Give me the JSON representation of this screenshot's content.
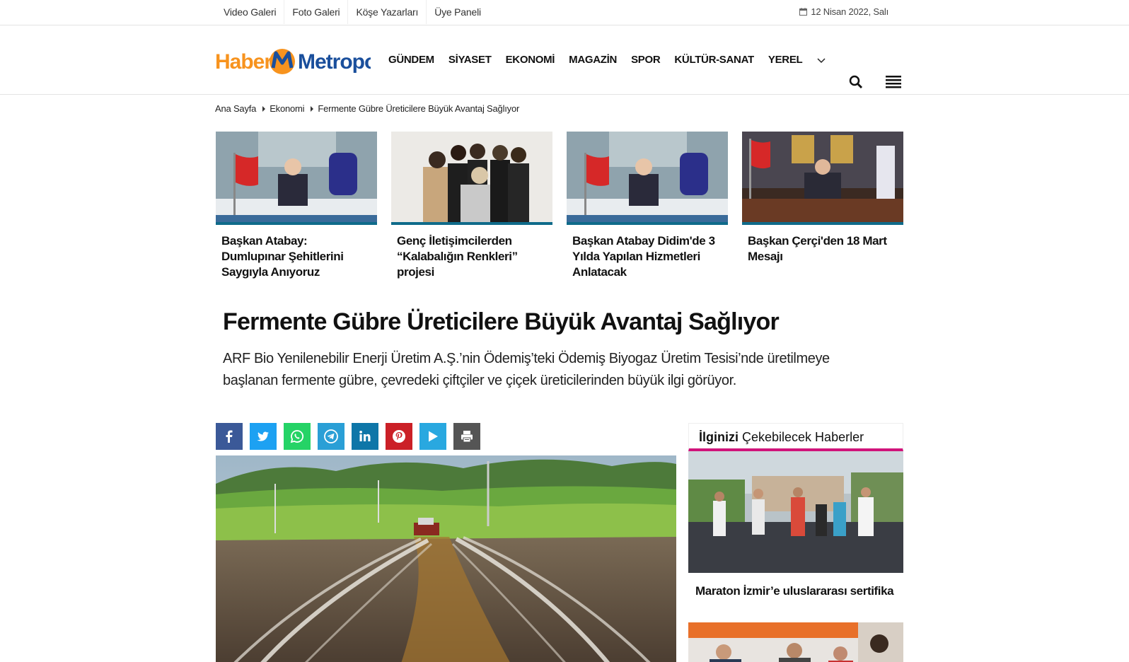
{
  "topbar": {
    "links": [
      "Video Galeri",
      "Foto Galeri",
      "Köşe Yazarları",
      "Üye Paneli"
    ],
    "date": "12 Nisan 2022, Salı"
  },
  "brand": {
    "left": "Haber",
    "right": "Metropol",
    "accent": "#f7931e",
    "blue": "#1a4f9c"
  },
  "nav": {
    "items": [
      "GÜNDEM",
      "SİYASET",
      "EKONOMİ",
      "MAGAZİN",
      "SPOR",
      "KÜLTÜR-SANAT",
      "YEREL"
    ]
  },
  "breadcrumb": {
    "items": [
      "Ana Sayfa",
      "Ekonomi",
      "Fermente Gübre Üreticilere Büyük Avantaj Sağlıyor"
    ]
  },
  "cards": [
    {
      "title": "Başkan Atabay: Dumlupınar Şehitlerini Saygıyla Anıyoruz"
    },
    {
      "title": "Genç İletişimcilerden “Kalabalığın Renkleri” projesi"
    },
    {
      "title": "Başkan Atabay Didim'de 3 Yılda Yapılan Hizmetleri Anlatacak"
    },
    {
      "title": "Başkan Çerçi'den 18 Mart Mesajı"
    }
  ],
  "article": {
    "title": "Fermente Gübre Üreticilere Büyük Avantaj Sağlıyor",
    "summary": "ARF Bio Yenilenebilir Enerji Üretim A.Ş.’nin Ödemiş’teki Ödemiş Biyogaz Üretim Tesisi’nde üretilmeye başlanan fermente gübre, çevredeki çiftçiler ve çiçek üreticilerinden büyük ilgi görüyor."
  },
  "share": [
    {
      "icon": "facebook-icon",
      "color": "#3b5998"
    },
    {
      "icon": "twitter-icon",
      "color": "#1da1f2"
    },
    {
      "icon": "whatsapp-icon",
      "color": "#25d366"
    },
    {
      "icon": "telegram-icon",
      "color": "#2a9fd6"
    },
    {
      "icon": "linkedin-icon",
      "color": "#0e76a8"
    },
    {
      "icon": "pinterest-icon",
      "color": "#cb2027"
    },
    {
      "icon": "play-icon",
      "color": "#29a8e0"
    },
    {
      "icon": "print-icon",
      "color": "#555555"
    }
  ],
  "sidebar": {
    "heading_bold": "İlginizi",
    "heading_rest": " Çekebilecek Haberler",
    "accent": "#d0137a",
    "items": [
      {
        "title": "Maraton İzmir’e uluslararası sertifika"
      }
    ]
  }
}
